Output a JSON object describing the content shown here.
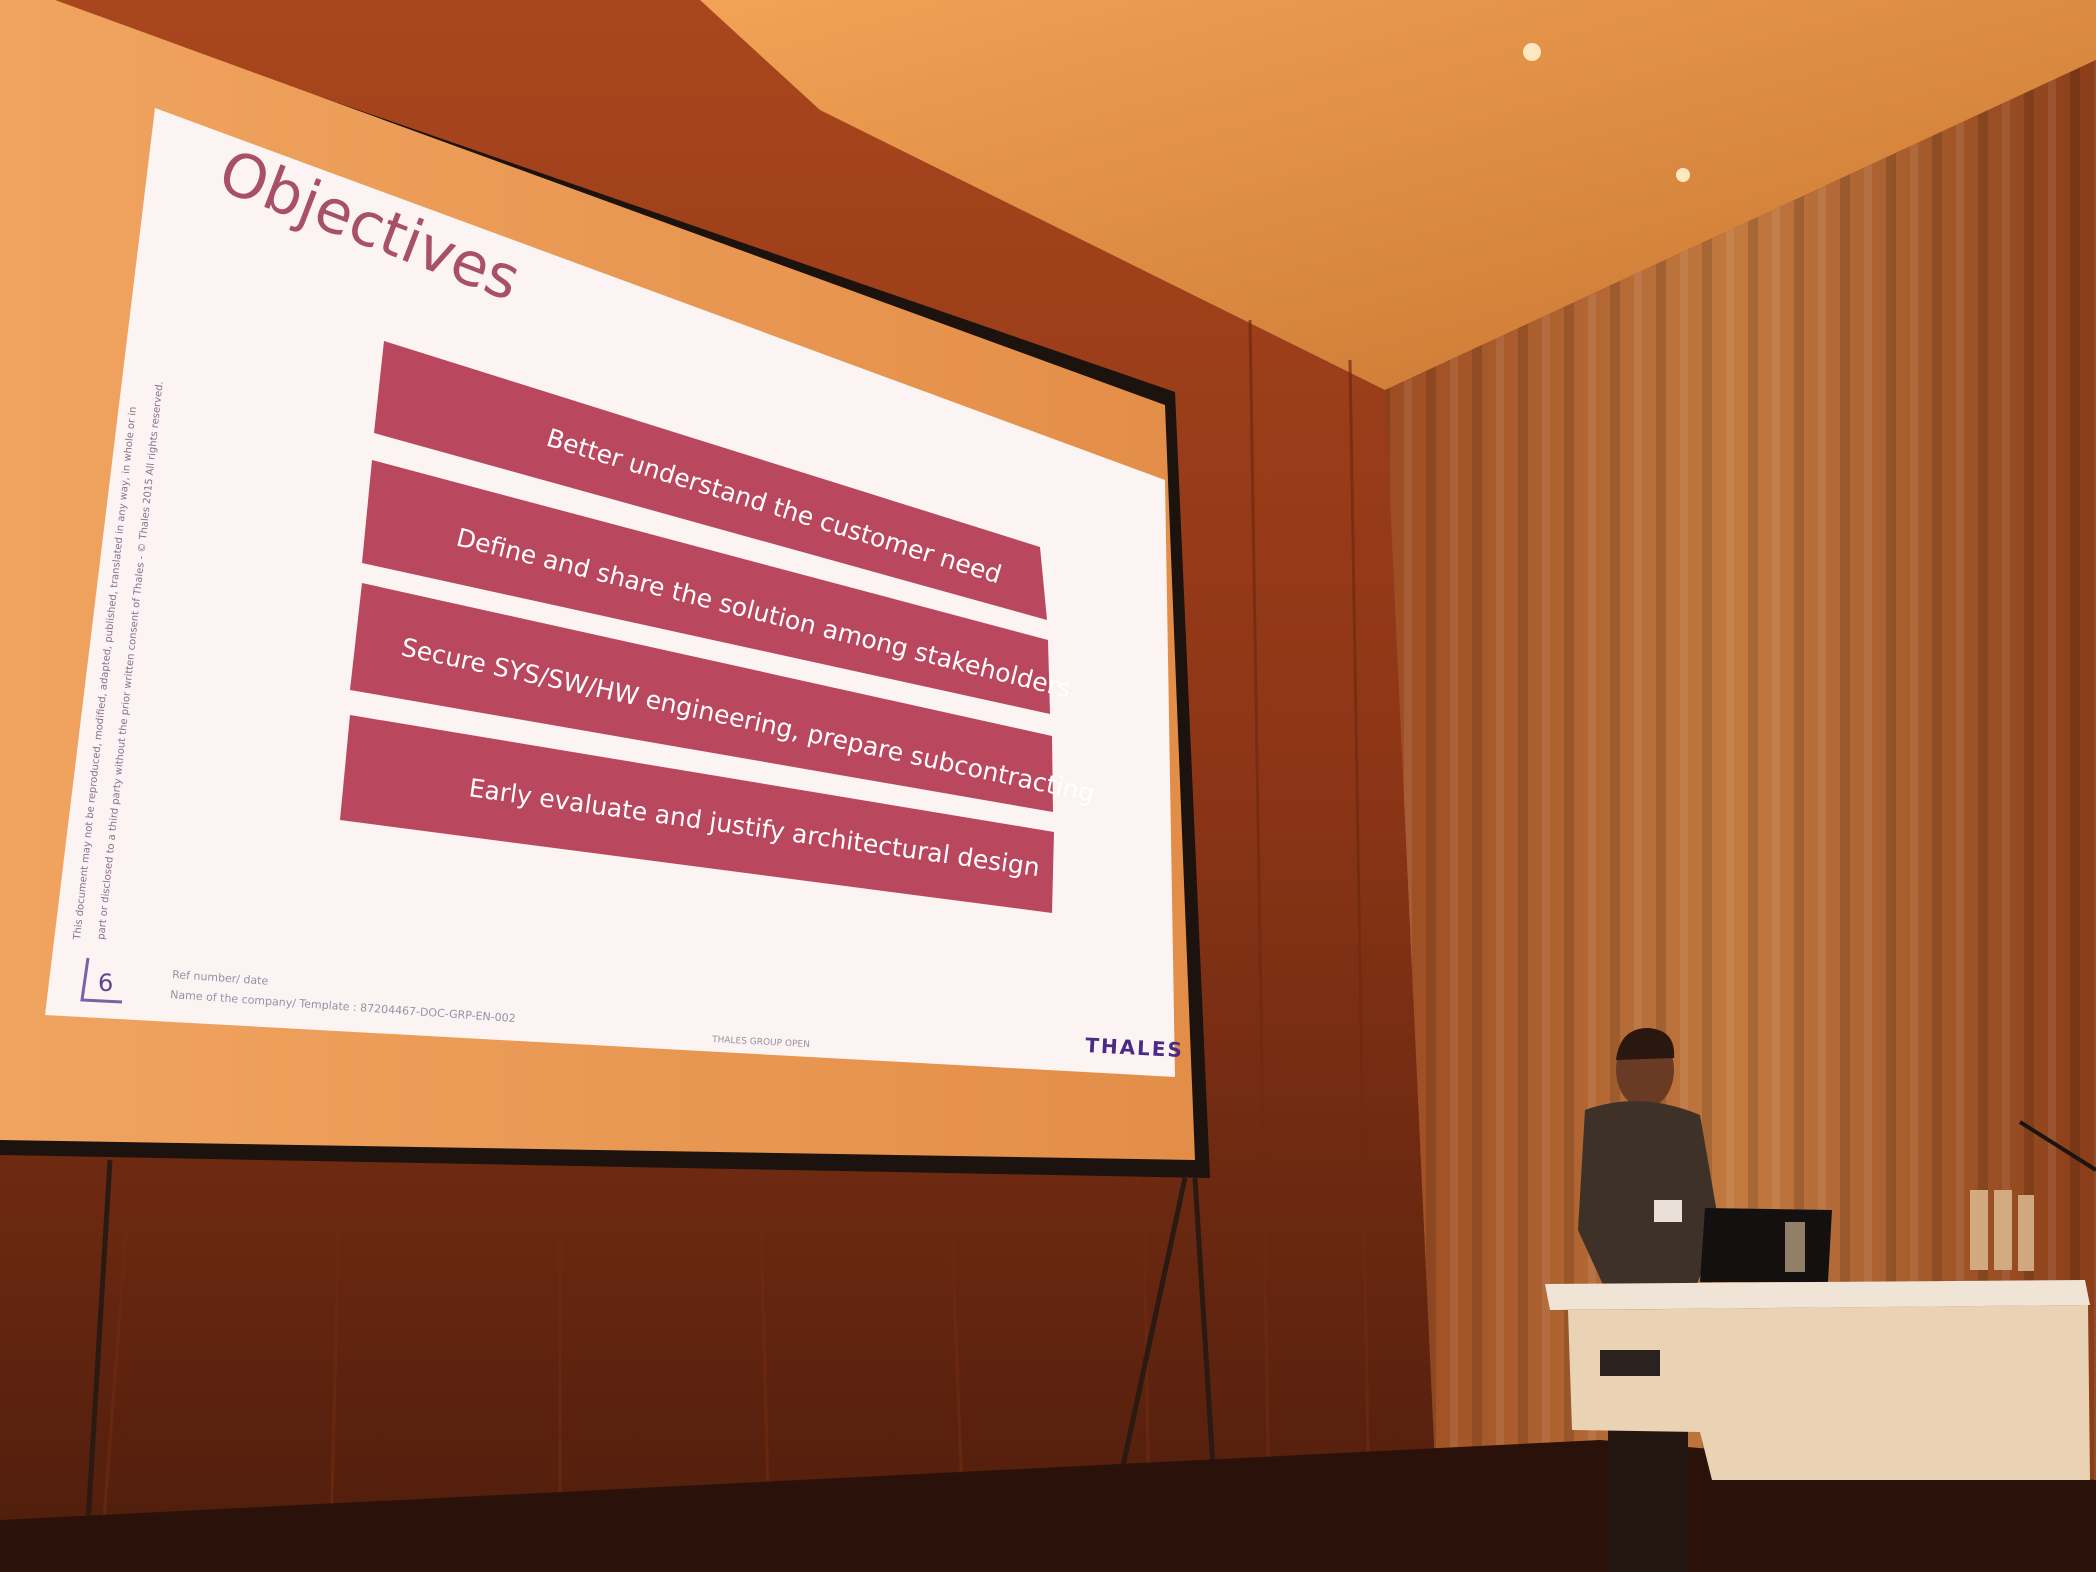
{
  "slide": {
    "title": "Objectives",
    "objectives": [
      "Better understand the customer need",
      "Define and share the solution among stakeholders",
      "Secure SYS/SW/HW engineering, prepare subcontracting",
      "Early evaluate and justify architectural design"
    ],
    "page_number": "6",
    "footer_ref": "Ref number/ date",
    "footer_template": "Name of the company/ Template : 87204467-DOC-GRP-EN-002",
    "classification": "THALES GROUP OPEN",
    "brand": "THALES",
    "disclaimer_line1": "This document may not be reproduced, modified, adapted, published, translated in any way, in whole or in",
    "disclaimer_line2": "part or disclosed to a third party without the prior written consent of Thales - © Thales 2015 All rights reserved."
  },
  "colors": {
    "objective_box": "#b9485e",
    "title": "#a85065",
    "brand": "#4b2a87",
    "slide_background": "#fbf4f3"
  },
  "icons": {
    "page_marker": "corner-bracket-icon"
  }
}
